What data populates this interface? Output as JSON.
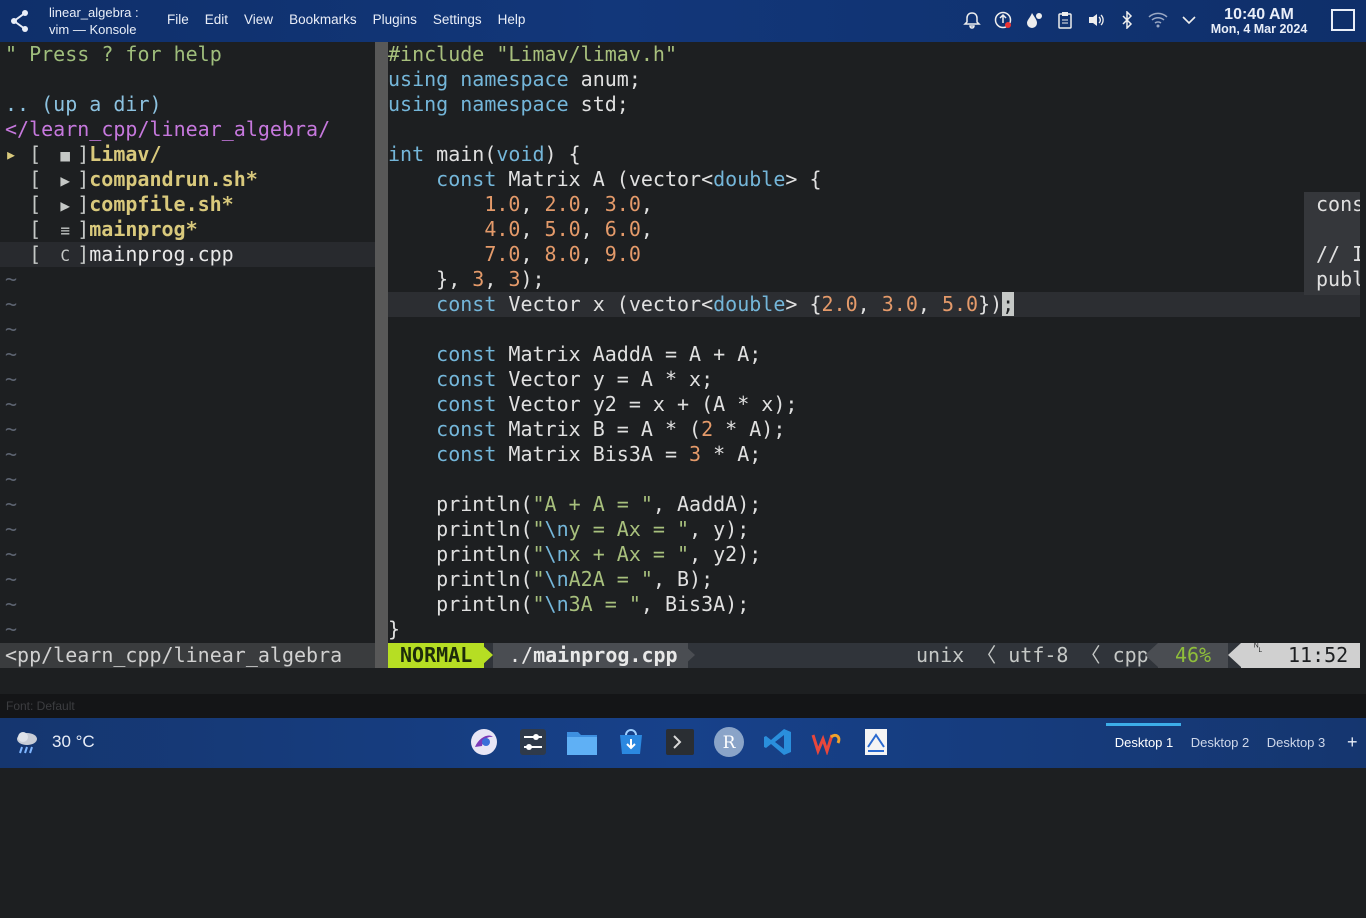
{
  "window": {
    "title_line1": "linear_algebra :",
    "title_line2": "vim — Konsole"
  },
  "menu": [
    "File",
    "Edit",
    "View",
    "Bookmarks",
    "Plugins",
    "Settings",
    "Help"
  ],
  "tray_icons": [
    "notifications-icon",
    "updates-icon",
    "vault-icon",
    "clipboard-icon",
    "volume-icon",
    "bluetooth-icon",
    "wifi-icon",
    "expand-tray-icon"
  ],
  "clock": {
    "time": "10:40 AM",
    "date": "Mon, 4 Mar 2024"
  },
  "nerdtree": {
    "help": "\" Press ? for help",
    "updir": ".. (up a dir)",
    "path": "</learn_cpp/linear_algebra/",
    "entries": [
      {
        "arrow": "▸",
        "icon": "folder-icon",
        "glyph": "■",
        "name": "Limav/",
        "type": "dir"
      },
      {
        "arrow": " ",
        "icon": "terminal-file-icon",
        "glyph": "▶",
        "name": "compandrun.sh*",
        "type": "exec"
      },
      {
        "arrow": " ",
        "icon": "terminal-file-icon",
        "glyph": "▶",
        "name": "compfile.sh*",
        "type": "exec"
      },
      {
        "arrow": " ",
        "icon": "text-file-icon",
        "glyph": "≡",
        "name": "mainprog*",
        "type": "exec"
      },
      {
        "arrow": " ",
        "icon": "cpp-file-icon",
        "glyph": "C",
        "name": "mainprog.cpp",
        "type": "file"
      }
    ],
    "tilde": "~",
    "status": "<pp/learn_cpp/linear_algebra"
  },
  "code_lines": [
    "#include \"Limav/limav.h\"",
    "using namespace anum;",
    "using namespace std;",
    "",
    "int main(void) {",
    "    const Matrix A (vector<double> {",
    "        1.0, 2.0, 3.0,",
    "        4.0, 5.0, 6.0,",
    "        7.0, 8.0, 9.0",
    "    }, 3, 3);",
    "    const Vector x (vector<double> {2.0, 3.0, 5.0});",
    "",
    "    const Matrix AaddA = A + A;",
    "    const Vector y = A * x;",
    "    const Vector y2 = x + (A * x);",
    "    const Matrix B = A * (2 * A);",
    "    const Matrix Bis3A = 3 * A;",
    "",
    "    println(\"A + A = \", AaddA);",
    "    println(\"\\ny = Ax = \", y);",
    "    println(\"\\nx + Ax = \", y2);",
    "    println(\"\\nA2A = \", B);",
    "    println(\"\\n3A = \", Bis3A);",
    "}"
  ],
  "hover_popup": {
    "line1": "constructor Vector",
    "line2": "",
    "line3": "// In Vector",
    "line4": "public: Vector(std::vector<double>)"
  },
  "statusline": {
    "mode": "NORMAL",
    "file_prefix": "./",
    "file_name": "mainprog.cpp",
    "fileformat": "unix",
    "encoding": "utf-8",
    "filetype": "cpp",
    "percent": "46%",
    "line_symbol": "␤",
    "position": "11:52",
    "sep": "〈"
  },
  "konsole_status": "Font: Default",
  "taskbar": {
    "temperature": "30 °C",
    "apps": [
      "browser-icon",
      "settings-icon",
      "file-manager-icon",
      "store-icon",
      "terminal-icon",
      "r-icon",
      "vscode-icon",
      "wps-icon",
      "okular-icon"
    ],
    "desktops": [
      "Desktop 1",
      "Desktop 2",
      "Desktop 3"
    ],
    "add": "+"
  },
  "colors": {
    "keyword": "#74b6d9",
    "number": "#e49a6a",
    "string": "#a8c07d",
    "mode_bg": "#b6de23",
    "dir": "#d9c97c",
    "path": "#c678dd"
  }
}
